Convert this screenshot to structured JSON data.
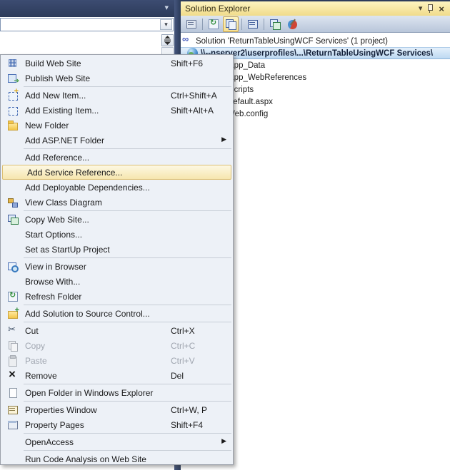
{
  "editor": {
    "nav_dropdown_value": "",
    "band_caret": "▾",
    "combo_caret": "▾"
  },
  "solution_explorer": {
    "title": "Solution Explorer",
    "titlebar": {
      "menu_caret": "▾",
      "close_label": "×"
    },
    "toolbar": [
      {
        "name": "properties",
        "active": false,
        "sep_after": true
      },
      {
        "name": "refresh",
        "active": false,
        "sep_after": false
      },
      {
        "name": "nest-related-files",
        "active": true,
        "sep_after": true
      },
      {
        "name": "view-designer",
        "active": false,
        "sep_after": true
      },
      {
        "name": "copy-web-site",
        "active": false,
        "sep_after": false
      },
      {
        "name": "aspnet-configuration",
        "active": false,
        "sep_after": false
      }
    ],
    "tree": [
      {
        "label": "Solution 'ReturnTableUsingWCF Services' (1 project)",
        "icon": "solution",
        "indent": 0,
        "selected": false
      },
      {
        "label": "\\\\--nserver2\\userprofiles\\...\\ReturnTableUsingWCF Services\\",
        "icon": "website",
        "indent": 1,
        "selected": true
      },
      {
        "label": "App_Data",
        "icon": "folder",
        "indent": 2,
        "selected": false
      },
      {
        "label": "App_WebReferences",
        "icon": "folder",
        "indent": 2,
        "selected": false
      },
      {
        "label": "Scripts",
        "icon": "folder",
        "indent": 2,
        "selected": false
      },
      {
        "label": "Default.aspx",
        "icon": "page",
        "indent": 2,
        "selected": false
      },
      {
        "label": "Web.config",
        "icon": "config",
        "indent": 2,
        "selected": false
      }
    ]
  },
  "context_menu": {
    "submenu_arrow": "▶",
    "items": [
      {
        "type": "item",
        "label": "Build Web Site",
        "shortcut": "Shift+F6",
        "icon": "build"
      },
      {
        "type": "item",
        "label": "Publish Web Site",
        "shortcut": "",
        "icon": "publish"
      },
      {
        "type": "separator"
      },
      {
        "type": "item",
        "label": "Add New Item...",
        "shortcut": "Ctrl+Shift+A",
        "icon": "add-new"
      },
      {
        "type": "item",
        "label": "Add Existing Item...",
        "shortcut": "Shift+Alt+A",
        "icon": "add-existing"
      },
      {
        "type": "item",
        "label": "New Folder",
        "shortcut": "",
        "icon": "folder"
      },
      {
        "type": "item",
        "label": "Add ASP.NET Folder",
        "shortcut": "",
        "icon": "",
        "submenu": true
      },
      {
        "type": "separator"
      },
      {
        "type": "item",
        "label": "Add Reference...",
        "shortcut": "",
        "icon": ""
      },
      {
        "type": "item",
        "label": "Add Service Reference...",
        "shortcut": "",
        "icon": "",
        "highlighted": true
      },
      {
        "type": "item",
        "label": "Add Deployable Dependencies...",
        "shortcut": "",
        "icon": ""
      },
      {
        "type": "item",
        "label": "View Class Diagram",
        "shortcut": "",
        "icon": "class-diagram"
      },
      {
        "type": "separator"
      },
      {
        "type": "item",
        "label": "Copy Web Site...",
        "shortcut": "",
        "icon": "copy-web"
      },
      {
        "type": "item",
        "label": "Start Options...",
        "shortcut": "",
        "icon": ""
      },
      {
        "type": "item",
        "label": "Set as StartUp Project",
        "shortcut": "",
        "icon": ""
      },
      {
        "type": "separator"
      },
      {
        "type": "item",
        "label": "View in Browser",
        "shortcut": "",
        "icon": "browser"
      },
      {
        "type": "item",
        "label": "Browse With...",
        "shortcut": "",
        "icon": ""
      },
      {
        "type": "item",
        "label": "Refresh Folder",
        "shortcut": "",
        "icon": "refresh"
      },
      {
        "type": "separator"
      },
      {
        "type": "item",
        "label": "Add Solution to Source Control...",
        "shortcut": "",
        "icon": "source-control"
      },
      {
        "type": "separator"
      },
      {
        "type": "item",
        "label": "Cut",
        "shortcut": "Ctrl+X",
        "icon": "cut"
      },
      {
        "type": "item",
        "label": "Copy",
        "shortcut": "Ctrl+C",
        "icon": "copy",
        "disabled": true
      },
      {
        "type": "item",
        "label": "Paste",
        "shortcut": "Ctrl+V",
        "icon": "paste",
        "disabled": true
      },
      {
        "type": "item",
        "label": "Remove",
        "shortcut": "Del",
        "icon": "remove"
      },
      {
        "type": "separator"
      },
      {
        "type": "item",
        "label": "Open Folder in Windows Explorer",
        "shortcut": "",
        "icon": "open-folder"
      },
      {
        "type": "separator"
      },
      {
        "type": "item",
        "label": "Properties Window",
        "shortcut": "Ctrl+W, P",
        "icon": "props-window"
      },
      {
        "type": "item",
        "label": "Property Pages",
        "shortcut": "Shift+F4",
        "icon": "prop-pages"
      },
      {
        "type": "separator"
      },
      {
        "type": "item",
        "label": "OpenAccess",
        "shortcut": "",
        "icon": "",
        "submenu": true
      },
      {
        "type": "separator"
      },
      {
        "type": "item",
        "label": "Run Code Analysis on Web Site",
        "shortcut": "",
        "icon": ""
      }
    ]
  }
}
